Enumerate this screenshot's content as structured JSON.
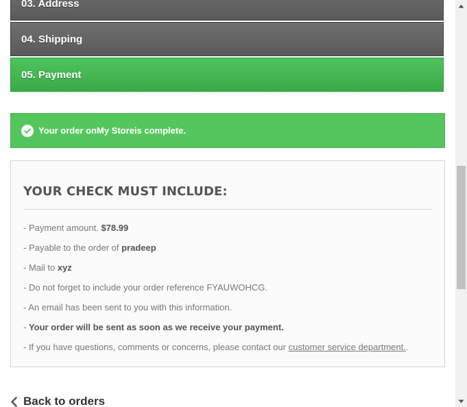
{
  "steps": {
    "address": "03. Address",
    "shipping": "04. Shipping",
    "payment": "05. Payment"
  },
  "alert": {
    "text_before": "Your order on ",
    "store": "My Store",
    "text_after": " is complete."
  },
  "check_box": {
    "title": "YOUR CHECK MUST INCLUDE:",
    "amount_label": "- Payment amount. ",
    "amount_value": "$78.99",
    "payable_label": "- Payable to the order of ",
    "payable_value": "pradeep",
    "mail_label": "- Mail to ",
    "mail_value": "xyz",
    "reference_text": "- Do not forget to include your order reference FYAUWOHCG.",
    "email_text": "- An email has been sent to you with this information.",
    "sent_prefix": "- ",
    "sent_text": "Your order will be sent as soon as we receive your payment.",
    "contact_text": "- If you have questions, comments or concerns, please contact our ",
    "contact_link": "customer service department.",
    "contact_end": "."
  },
  "back_link": "Back to orders",
  "colors": {
    "step_gray": "#5f5f5f",
    "step_green": "#46b552",
    "alert_green": "#55c65e"
  }
}
